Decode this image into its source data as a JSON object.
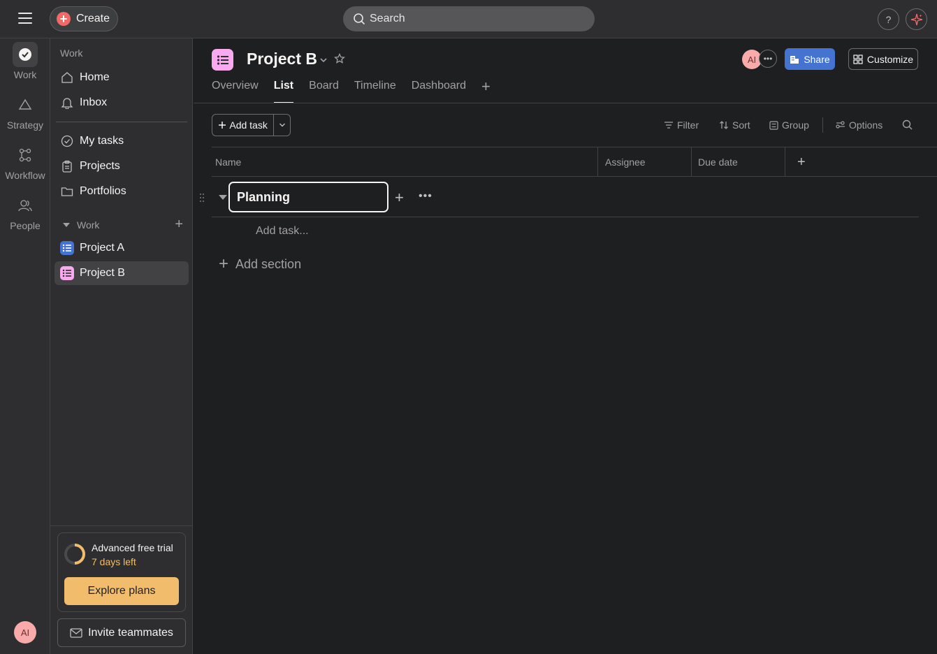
{
  "topbar": {
    "create_label": "Create",
    "search_label": "Search",
    "help_label": "?"
  },
  "rail": {
    "items": [
      {
        "label": "Work",
        "icon": "check-circle-icon"
      },
      {
        "label": "Strategy",
        "icon": "triangle-icon"
      },
      {
        "label": "Workflow",
        "icon": "workflow-icon"
      },
      {
        "label": "People",
        "icon": "people-icon"
      }
    ],
    "avatar": "AI"
  },
  "sidebar": {
    "heading": "Work",
    "nav": [
      {
        "label": "Home",
        "icon": "home-icon"
      },
      {
        "label": "Inbox",
        "icon": "bell-icon"
      }
    ],
    "nav2": [
      {
        "label": "My tasks",
        "icon": "check-circle-icon"
      },
      {
        "label": "Projects",
        "icon": "clipboard-icon"
      },
      {
        "label": "Portfolios",
        "icon": "folder-icon"
      }
    ],
    "section_label": "Work",
    "projects": [
      {
        "label": "Project A",
        "color": "#4573d2"
      },
      {
        "label": "Project B",
        "color": "#f9aaef"
      }
    ],
    "trial": {
      "title": "Advanced free trial",
      "days_left": "7 days left",
      "explore_label": "Explore plans"
    },
    "invite_label": "Invite teammates"
  },
  "project": {
    "title": "Project B",
    "color": "#f9aaef",
    "member_avatar": "AI",
    "share_label": "Share",
    "customize_label": "Customize",
    "tabs": [
      {
        "label": "Overview",
        "active": false
      },
      {
        "label": "List",
        "active": true
      },
      {
        "label": "Board",
        "active": false
      },
      {
        "label": "Timeline",
        "active": false
      },
      {
        "label": "Dashboard",
        "active": false
      }
    ]
  },
  "toolbar": {
    "add_task_label": "Add task",
    "filter_label": "Filter",
    "sort_label": "Sort",
    "group_label": "Group",
    "options_label": "Options"
  },
  "table": {
    "columns": [
      "Name",
      "Assignee",
      "Due date"
    ],
    "section_name": "Planning",
    "add_task_placeholder": "Add task...",
    "add_section_label": "Add section"
  },
  "colors": {
    "accent_blue": "#4573d2",
    "create_red": "#f06a6a",
    "trial_orange": "#f1bd6c"
  }
}
